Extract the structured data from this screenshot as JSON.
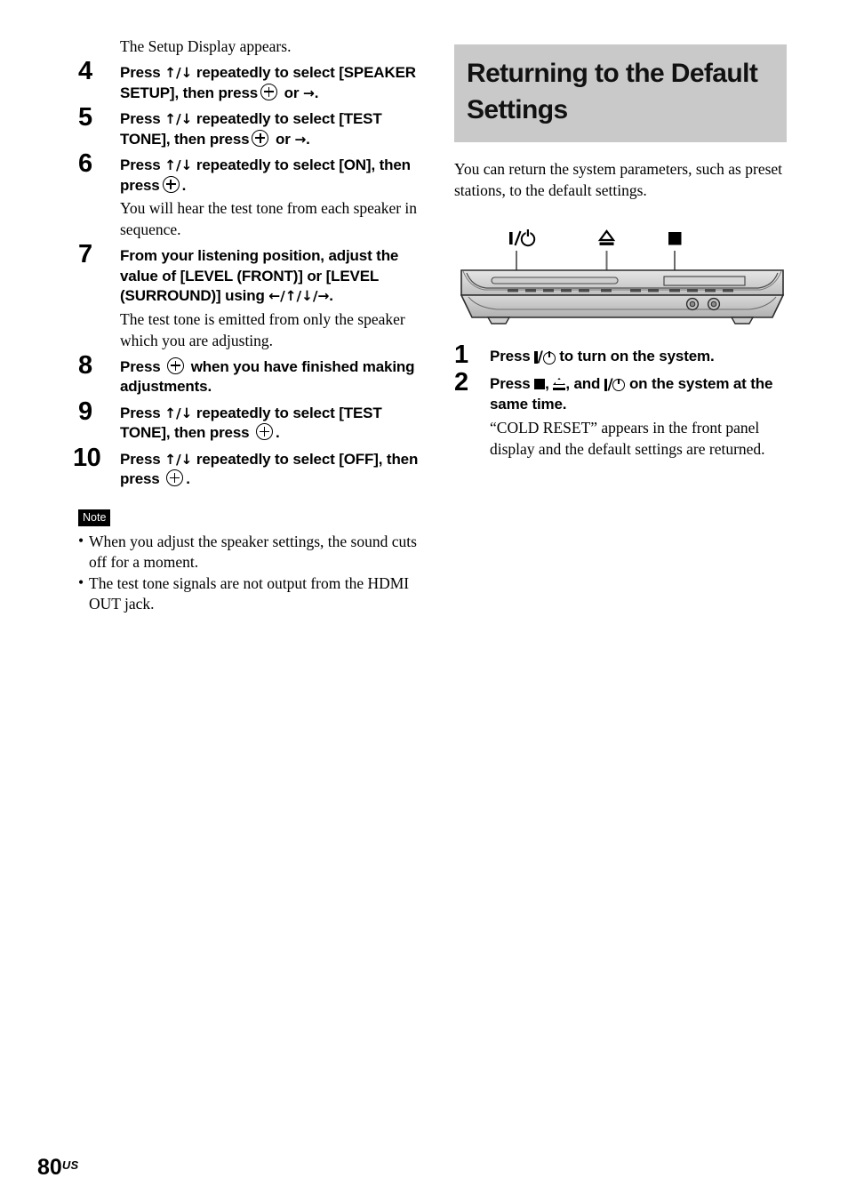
{
  "page": {
    "number": "80",
    "region_suffix": "US"
  },
  "left_column": {
    "intro_line": "The Setup Display appears.",
    "steps": [
      {
        "number": "4",
        "title_parts": [
          "Press ",
          "↑/↓",
          " repeatedly to select [SPEAKER SETUP], then press ",
          "enter-icon",
          " or ",
          "→",
          "."
        ],
        "title_text": "Press ↑/↓ repeatedly to select [SPEAKER SETUP], then press ⊕ or →.",
        "sub": ""
      },
      {
        "number": "5",
        "title_text": "Press ↑/↓ repeatedly to select [TEST TONE], then press ⊕ or →.",
        "sub": ""
      },
      {
        "number": "6",
        "title_text": "Press ↑/↓ repeatedly to select [ON], then press ⊕.",
        "sub": "You will hear the test tone from each speaker in sequence."
      },
      {
        "number": "7",
        "title_text": "From your listening position, adjust the value of [LEVEL (FRONT)] or [LEVEL (SURROUND)] using ←/↑/↓/→.",
        "sub": "The test tone is emitted from only the speaker which you are adjusting."
      },
      {
        "number": "8",
        "title_text": "Press ⊕ when you have finished making adjustments.",
        "sub": ""
      },
      {
        "number": "9",
        "title_text": "Press ↑/↓ repeatedly to select [TEST TONE], then press ⊕.",
        "sub": ""
      },
      {
        "number": "10",
        "title_text": "Press ↑/↓ repeatedly to select [OFF], then press ⊕.",
        "sub": ""
      }
    ],
    "step4": {
      "t1": "Press ",
      "arrows": "↑/↓",
      "t2": " repeatedly to select",
      "t3": "[SPEAKER SETUP], then press",
      "t4": " or",
      "t5": "→",
      "t6": "."
    },
    "step5": {
      "t1": "Press ",
      "arrows": "↑/↓",
      "t2": " repeatedly to select [TEST",
      "t3": "TONE], then press",
      "t4": " or ",
      "t5": "→",
      "t6": "."
    },
    "step6": {
      "t1": "Press ",
      "arrows": "↑/↓",
      "t2": " repeatedly to select [ON],",
      "t3": "then press",
      "t4": ".",
      "sub": "You will hear the test tone from each speaker in sequence."
    },
    "step7": {
      "t1": "From your listening position, adjust the value of [LEVEL (FRONT)] or [LEVEL (SURROUND)] using ",
      "arrows": "←/↑/↓/→",
      "t2": ".",
      "sub": "The test tone is emitted from only the speaker which you are adjusting."
    },
    "step8": {
      "t1": "Press ",
      "t2": " when you have finished making adjustments."
    },
    "step9": {
      "t1": "Press ",
      "arrows": "↑/↓",
      "t2": " repeatedly to select [TEST TONE], then press ",
      "t3": "."
    },
    "step10": {
      "t1": "Press ",
      "arrows": "↑/↓",
      "t2": " repeatedly to select [OFF], then press ",
      "t3": "."
    },
    "note": {
      "badge": "Note",
      "items": [
        "When you adjust the speaker settings, the sound cuts off for a moment.",
        "The test tone signals are not output from the HDMI OUT jack."
      ]
    }
  },
  "right_column": {
    "heading": "Returning to the Default Settings",
    "heading_bg": "#c9c9c9",
    "lead": "You can return the system parameters, such as preset stations, to the default settings.",
    "figure": {
      "callouts": [
        {
          "symbol": "power-symbol",
          "label": "I/⏻"
        },
        {
          "symbol": "eject-symbol",
          "label": "⏏"
        },
        {
          "symbol": "stop-symbol",
          "label": "■"
        }
      ],
      "device": "front-panel-illustration"
    },
    "steps": {
      "step1": {
        "number": "1",
        "t1": "Press ",
        "t2": " to turn on the system."
      },
      "step2": {
        "number": "2",
        "t1": "Press ",
        "t2": ", ",
        "t3": ", and ",
        "t4": " on the system at the same time.",
        "sub": "“COLD RESET” appears in the front panel display and the default settings are returned."
      }
    }
  }
}
